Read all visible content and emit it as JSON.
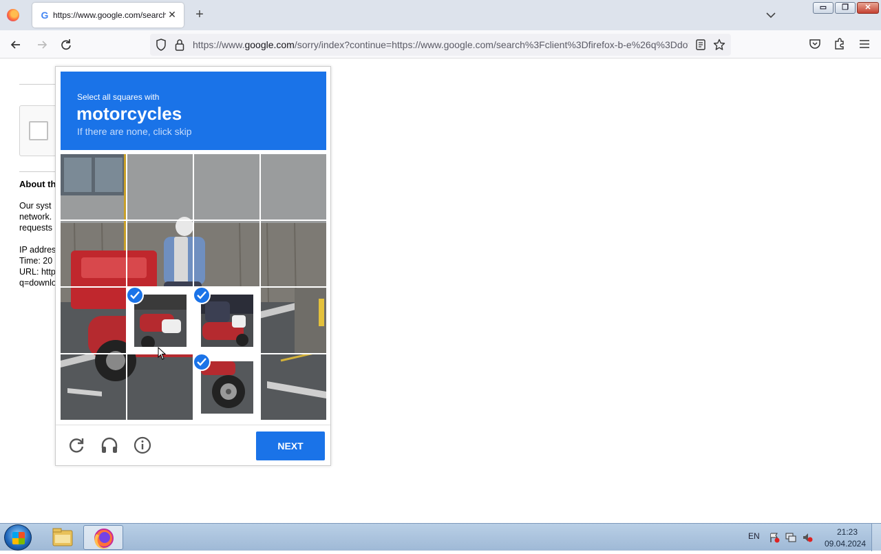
{
  "browser": {
    "tab_title": "https://www.google.com/search",
    "tab_favicon": "G",
    "url_domain_prefix": "https://www.",
    "url_domain": "google.com",
    "url_rest": "/sorry/index?continue=https://www.google.com/search%3Fclient%3Dfirefox-b-e%26q%3Ddov",
    "new_tab": "+",
    "tab_close": "✕"
  },
  "window_controls": {
    "minimize": "▭",
    "maximize": "❐",
    "close": "✕"
  },
  "background_page": {
    "about_heading": "About th",
    "lines": [
      "Our syst",
      "network.",
      "requests",
      "IP addres",
      "Time: 20",
      "URL: http",
      "q=downlo"
    ]
  },
  "captcha": {
    "instruction": "Select all squares with",
    "target": "motorcycles",
    "hint": "If there are none, click skip",
    "next_label": "NEXT",
    "selected_tiles": [
      9,
      10,
      14
    ],
    "accent": "#1a73e8"
  },
  "taskbar": {
    "language": "EN",
    "time": "21:23",
    "date": "09.04.2024"
  }
}
